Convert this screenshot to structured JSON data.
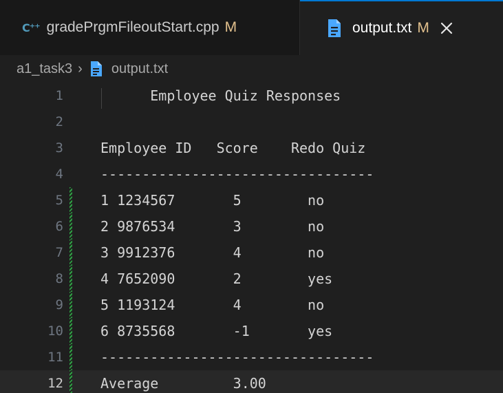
{
  "tabs": [
    {
      "icon": "cpp-file-icon",
      "icon_glyph": "C⁺⁺",
      "label": "gradePrgmFileoutStart.cpp",
      "status": "M",
      "active": false
    },
    {
      "icon": "text-file-icon",
      "label": "output.txt",
      "status": "M",
      "active": true,
      "close_glyph": "close-icon"
    }
  ],
  "breadcrumb": {
    "folder": "a1_task3",
    "separator": "›",
    "file": "output.txt"
  },
  "editor": {
    "current_line": 12,
    "modified_lines": [
      5,
      6,
      7,
      8,
      9,
      10,
      11,
      12
    ],
    "lines": [
      {
        "num": "1",
        "text": "      Employee Quiz Responses"
      },
      {
        "num": "2",
        "text": ""
      },
      {
        "num": "3",
        "text": "Employee ID   Score    Redo Quiz"
      },
      {
        "num": "4",
        "text": "---------------------------------"
      },
      {
        "num": "5",
        "text": "1 1234567       5        no"
      },
      {
        "num": "6",
        "text": "2 9876534       3        no"
      },
      {
        "num": "7",
        "text": "3 9912376       4        no"
      },
      {
        "num": "8",
        "text": "4 7652090       2        yes"
      },
      {
        "num": "9",
        "text": "5 1193124       4        no"
      },
      {
        "num": "10",
        "text": "6 8735568       -1       yes"
      },
      {
        "num": "11",
        "text": "---------------------------------"
      },
      {
        "num": "12",
        "text": "Average         3.00"
      }
    ]
  },
  "colors": {
    "editor_bg": "#1f1f1f",
    "tabbar_bg": "#181818",
    "active_tab_border": "#0078d4",
    "modified_status": "#e2c08d",
    "gutter_modified": "#2ea043",
    "line_number": "#6e7681"
  }
}
